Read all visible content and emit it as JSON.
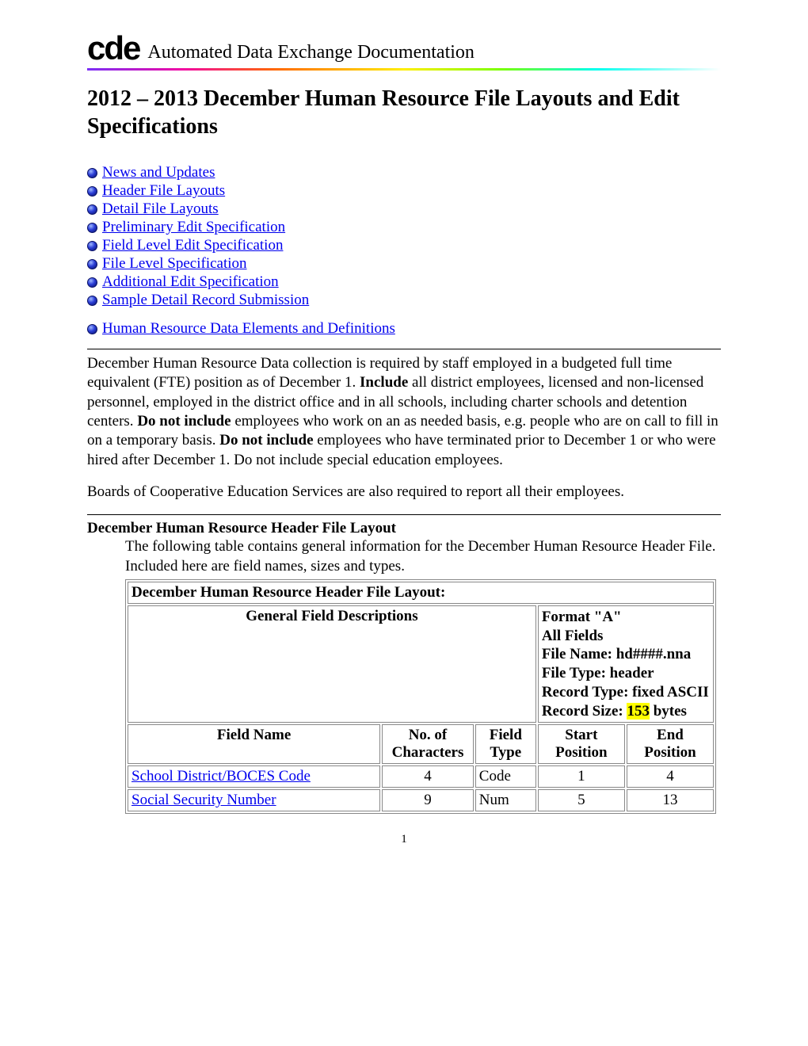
{
  "header": {
    "logo_text": "cde",
    "subtitle": "Automated Data Exchange Documentation"
  },
  "title": "2012 – 2013 December Human Resource File Layouts and Edit Specifications",
  "nav_group_1": [
    "News and Updates",
    "Header File Layouts",
    "Detail File Layouts",
    "Preliminary Edit Specification",
    "Field Level Edit Specification",
    "File Level Specification",
    "Additional Edit Specification",
    "Sample Detail Record Submission"
  ],
  "nav_group_2": [
    "Human Resource Data Elements and Definitions "
  ],
  "body": {
    "p1_a": "December Human Resource Data collection is required by staff employed in a budgeted full time equivalent (FTE) position as of December 1. ",
    "p1_bold1": "Include",
    "p1_b": " all district employees, licensed and non-licensed personnel, employed in the district office and in all schools, including charter schools and detention centers. ",
    "p1_bold2": "Do not include",
    "p1_c": " employees who work on an as needed basis, e.g. people who are on call to fill in on a temporary basis. ",
    "p1_bold3": "Do not include",
    "p1_d": " employees who have terminated prior to December 1 or who were hired after December 1. Do not include special education employees.",
    "p2": "Boards of Cooperative Education Services are also required to report all their employees."
  },
  "section": {
    "head": "December Human Resource Header File Layout",
    "desc": "The following table contains general information for the December Human Resource Header File. Included here are field names, sizes and types."
  },
  "table": {
    "title": "December Human Resource Header File Layout:",
    "desc_label": "General Field Descriptions",
    "info": {
      "l1": "Format \"A\"",
      "l2": "All Fields",
      "l3": "File Name: hd####.nna",
      "l4": "File Type: header",
      "l5": "Record Type: fixed ASCII",
      "l6a": "Record Size: ",
      "l6_hl": "153",
      "l6b": " bytes"
    },
    "cols": [
      "Field Name",
      "No. of Characters",
      "Field Type",
      "Start Position",
      "End Position"
    ],
    "rows": [
      {
        "name": "School District/BOCES Code",
        "chars": "4",
        "type": "Code",
        "start": "1",
        "end": "4"
      },
      {
        "name": "Social Security Number",
        "chars": "9",
        "type": "Num",
        "start": "5",
        "end": "13"
      }
    ]
  },
  "page_number": "1"
}
